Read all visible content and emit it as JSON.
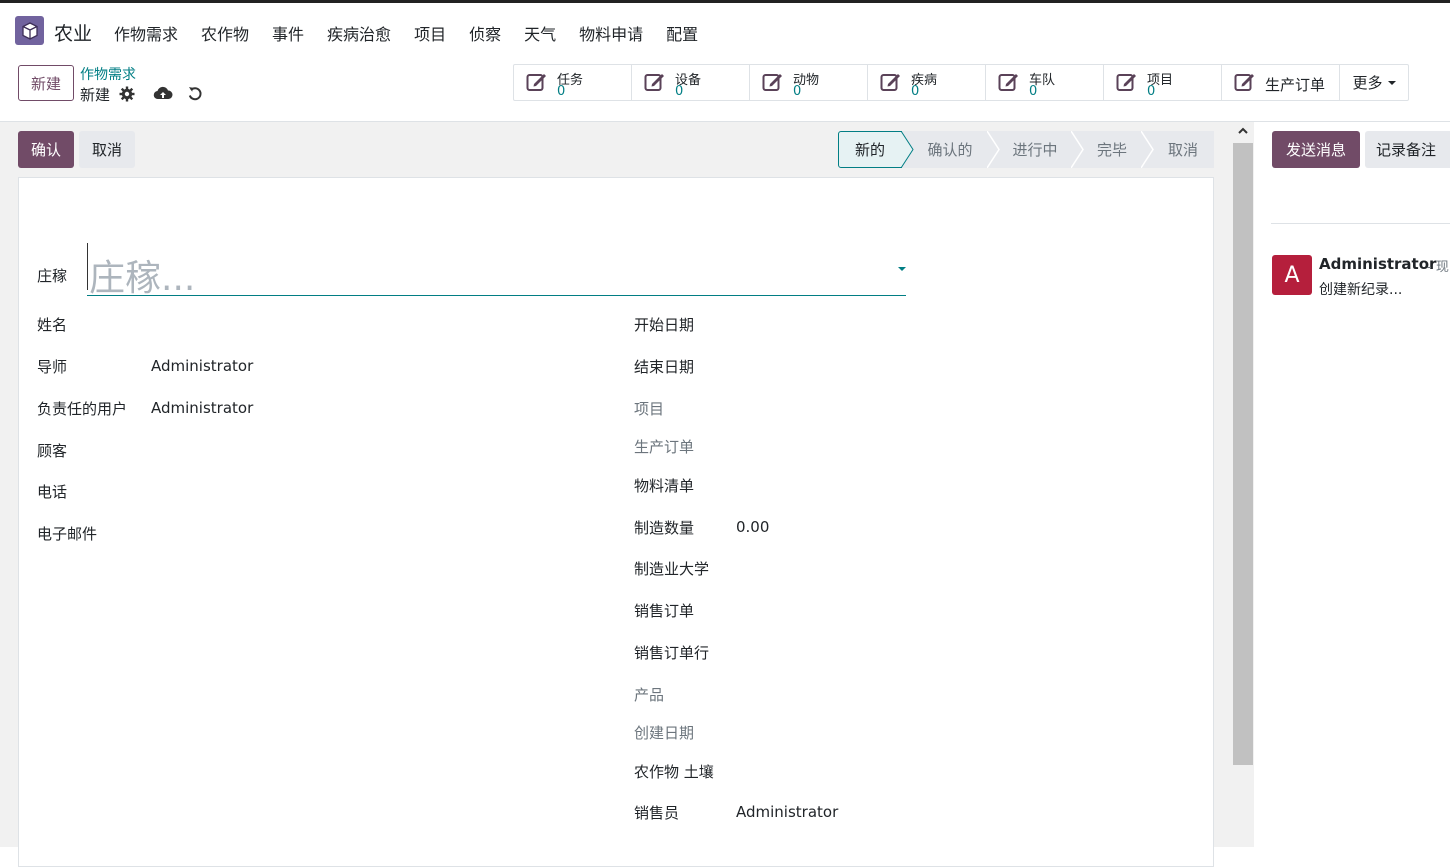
{
  "navbar": {
    "app_name": "农业",
    "menu": [
      "作物需求",
      "农作物",
      "事件",
      "疾病治愈",
      "项目",
      "侦察",
      "天气",
      "物料申请",
      "配置"
    ]
  },
  "control_panel": {
    "new_button": "新建",
    "breadcrumb_parent": "作物需求",
    "breadcrumb_current": "新建",
    "smart_buttons": [
      {
        "label": "任务",
        "count": "0"
      },
      {
        "label": "设备",
        "count": "0"
      },
      {
        "label": "动物",
        "count": "0"
      },
      {
        "label": "疾病",
        "count": "0"
      },
      {
        "label": "车队",
        "count": "0"
      },
      {
        "label": "项目",
        "count": "0"
      },
      {
        "label": "生产订单",
        "count": ""
      }
    ],
    "more_label": "更多"
  },
  "form": {
    "confirm_button": "确认",
    "cancel_button": "取消",
    "statusbar": [
      "新的",
      "确认的",
      "进行中",
      "完毕",
      "取消"
    ],
    "active_stage": "新的",
    "title_label": "庄稼",
    "title_placeholder": "庄稼...",
    "left_fields": [
      {
        "label": "姓名",
        "value": ""
      },
      {
        "label": "导师",
        "value": "Administrator"
      },
      {
        "label": "负责任的用户",
        "value": "Administrator"
      },
      {
        "label": "顾客",
        "value": ""
      },
      {
        "label": "电话",
        "value": ""
      },
      {
        "label": "电子邮件",
        "value": ""
      }
    ],
    "right_fields": [
      {
        "label": "开始日期",
        "value": ""
      },
      {
        "label": "结束日期",
        "value": ""
      },
      {
        "label": "项目",
        "value": ""
      },
      {
        "label": "生产订单",
        "value": ""
      },
      {
        "label": "物料清单",
        "value": ""
      },
      {
        "label": "制造数量",
        "value": "0.00"
      },
      {
        "label": "制造业大学",
        "value": ""
      },
      {
        "label": "销售订单",
        "value": ""
      },
      {
        "label": "销售订单行",
        "value": ""
      },
      {
        "label": "产品",
        "value": ""
      },
      {
        "label": "创建日期",
        "value": ""
      },
      {
        "label": "农作物 土壤",
        "value": ""
      },
      {
        "label": "销售员",
        "value": "Administrator"
      }
    ]
  },
  "chatter": {
    "send_message": "发送消息",
    "log_note": "记录备注",
    "message": {
      "avatar_letter": "A",
      "author": "Administrator",
      "time": "- 现",
      "body": "创建新纪录..."
    }
  },
  "colors": {
    "brand": "#714b67",
    "link": "#017e84",
    "avatar": "#b51f3c"
  }
}
